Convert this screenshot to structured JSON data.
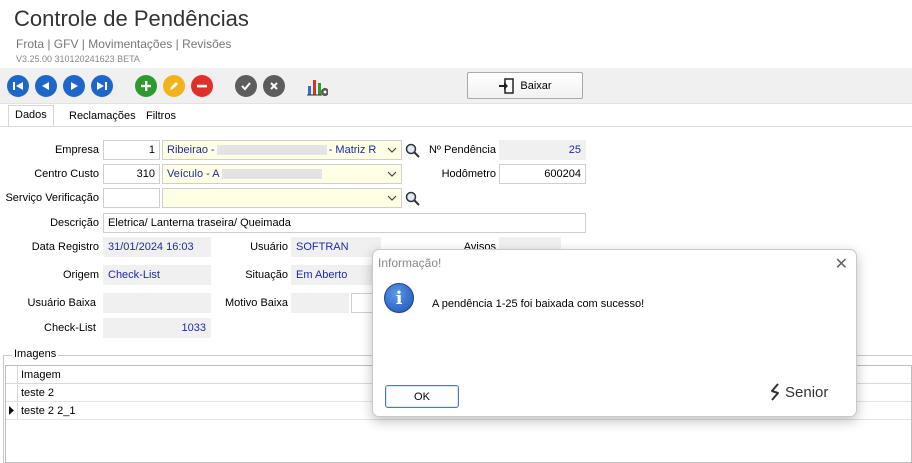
{
  "header": {
    "title": "Controle de Pendências",
    "breadcrumb": "Frota | GFV | Movimentações | Revisões",
    "version": "V3.25.00 310120241623 BETA"
  },
  "toolbar": {
    "nav_buttons": [
      "first-icon",
      "prev-icon",
      "next-icon",
      "last-icon"
    ],
    "edit_buttons": [
      "add-icon",
      "edit-icon",
      "remove-icon"
    ],
    "confirm_buttons": [
      "confirm-icon",
      "cancel-icon"
    ],
    "report_icon": "report-settings-icon",
    "baixar_label": "Baixar",
    "colors": {
      "nav": "#1f66c9",
      "add": "#2e9a2e",
      "edit": "#f2b21b",
      "remove": "#e0302a",
      "confirm": "#5d5d5d"
    }
  },
  "tabs": [
    {
      "label": "Dados",
      "active": true
    },
    {
      "label": "Reclamações",
      "active": false
    },
    {
      "label": "Filtros",
      "active": false
    }
  ],
  "form": {
    "empresa": {
      "label": "Empresa",
      "code": "1",
      "name_prefix": "Ribeirao -",
      "name_suffix": "- Matriz R"
    },
    "centro_custo": {
      "label": "Centro Custo",
      "code": "310",
      "name_prefix": "Veículo - A"
    },
    "servico_verificacao": {
      "label": "Serviço Verificação",
      "code": "",
      "name": ""
    },
    "descricao": {
      "label": "Descrição",
      "value": "Eletrica/ Lanterna traseira/ Queimada"
    },
    "n_pendencia": {
      "label": "Nº Pendência",
      "value": "25"
    },
    "hodometro": {
      "label": "Hodômetro",
      "value": "600204"
    },
    "data_registro": {
      "label": "Data Registro",
      "value": "31/01/2024 16:03"
    },
    "usuario": {
      "label": "Usuário",
      "value": "SOFTRAN"
    },
    "avisos": {
      "label": "Avisos",
      "value": ""
    },
    "origem": {
      "label": "Origem",
      "value": "Check-List"
    },
    "situacao": {
      "label": "Situação",
      "value": "Em Aberto"
    },
    "usuario_baixa": {
      "label": "Usuário Baixa",
      "value": ""
    },
    "motivo_baixa": {
      "label": "Motivo Baixa",
      "value": ""
    },
    "check_list": {
      "label": "Check-List",
      "value": "1033"
    }
  },
  "imagens": {
    "title": "Imagens",
    "column": "Imagem",
    "rows": [
      "teste 2",
      "teste 2 2_1"
    ],
    "current_row": 1
  },
  "dialog": {
    "title": "Informação!",
    "close": "✕",
    "message": "A pendência 1-25 foi baixada com sucesso!",
    "ok_label": "OK",
    "logo_text": "Senior"
  }
}
